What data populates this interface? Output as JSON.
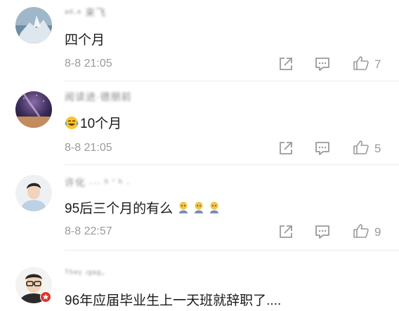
{
  "comments": [
    {
      "username": "ᵃᵈ·ᵉ 来飞",
      "text": "四个月",
      "time": "8-8 21:05",
      "likes": "7",
      "emoji": []
    },
    {
      "username": "阅读进·德朋前",
      "text": "10个月",
      "time": "8-8 21:05",
      "likes": "5",
      "emoji": [
        "laugh-cry"
      ]
    },
    {
      "username": "许化 ··· ʰ ' ʰ ·",
      "text": "95后三个月的有么",
      "time": "8-8 22:57",
      "likes": "9",
      "emoji": [
        "doll",
        "doll",
        "doll"
      ]
    },
    {
      "username": "ᵀʰᵉᵞ ᶦᵍᵃᵍ-",
      "text": "96年应届毕业生上一天班就辞职了....",
      "time": "",
      "likes": "",
      "emoji": []
    }
  ],
  "icons": {
    "share": "share-icon",
    "reply": "comment-icon",
    "like": "thumbs-up-icon"
  }
}
